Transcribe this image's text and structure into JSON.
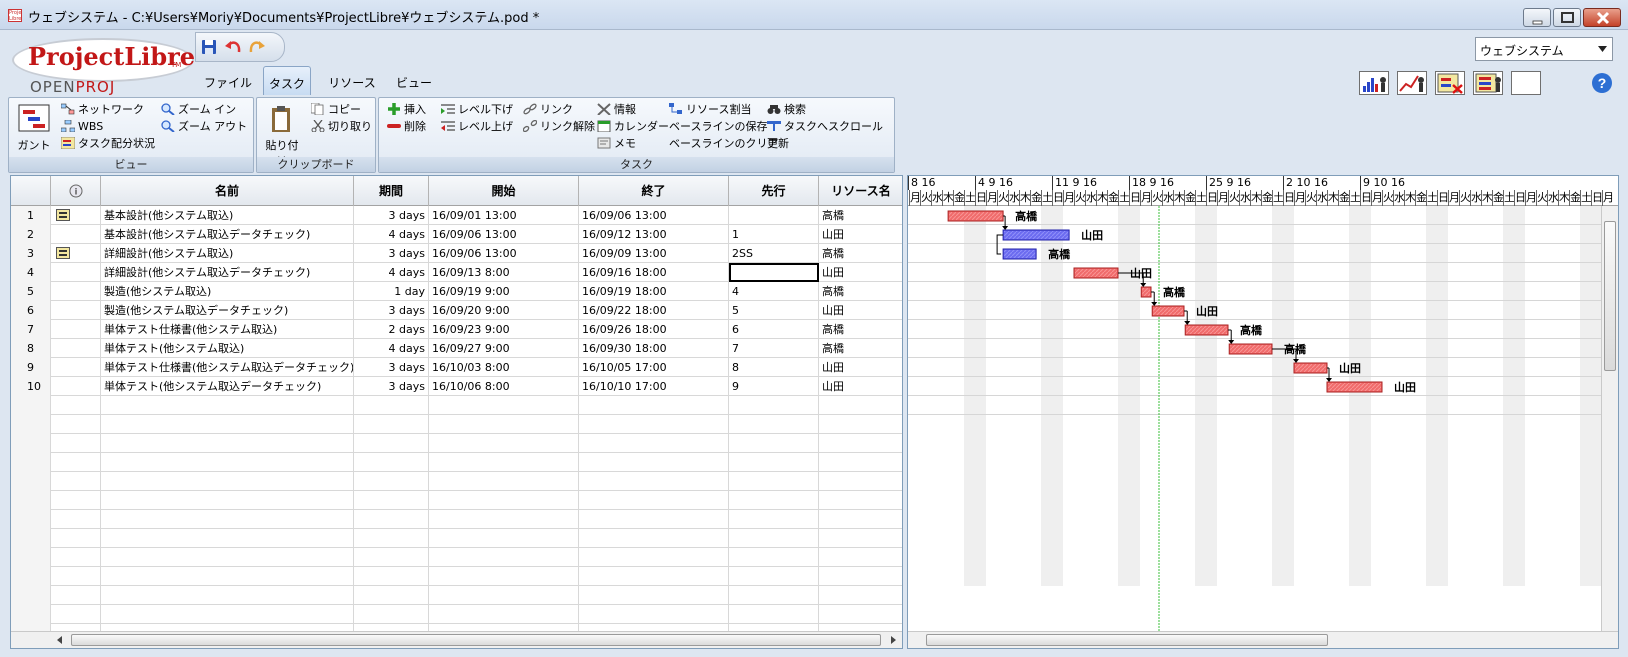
{
  "window": {
    "title": "ウェブシステム - C:¥Users¥Moriy¥Documents¥ProjectLibre¥ウェブシステム.pod *",
    "logo_small": "Project Libre"
  },
  "logo": {
    "main": "ProjectLibre",
    "tm": "TM",
    "sub_open": "OPEN",
    "sub_proj": "PROJ"
  },
  "tabs": [
    "ファイル",
    "タスク",
    "リソース",
    "ビュー"
  ],
  "active_tab": "タスク",
  "project_selector": {
    "value": "ウェブシステム"
  },
  "ribbon": {
    "view_group": {
      "label": "ビュー",
      "gantt": "ガント",
      "network": "ネットワーク",
      "wbs": "WBS",
      "task_usage": "タスク配分状況",
      "zoom_in": "ズーム イン",
      "zoom_out": "ズーム アウト"
    },
    "clipboard_group": {
      "label": "クリップボード",
      "paste": "貼り付け",
      "copy": "コピー",
      "cut": "切り取り"
    },
    "task_group": {
      "label": "タスク",
      "insert": "挿入",
      "delete": "削除",
      "indent": "レベル下げ",
      "outdent": "レベル上げ",
      "link": "リンク",
      "unlink": "リンク解除",
      "info": "情報",
      "calendar": "カレンダー",
      "notes": "メモ",
      "assign_resources": "リソース割当",
      "save_baseline": "ベースラインの保存",
      "clear_baseline": "ベースラインのクリア",
      "find": "検索",
      "scroll_to_task": "タスクへスクロール",
      "update": "更新"
    }
  },
  "table": {
    "columns": [
      "",
      "",
      "名前",
      "期間",
      "開始",
      "終了",
      "先行",
      "リソース名"
    ],
    "rows": [
      {
        "id": "1",
        "icon": true,
        "name": "基本設計(他システム取込)",
        "duration": "3 days",
        "start": "16/09/01 13:00",
        "finish": "16/09/06 13:00",
        "pred": "",
        "resource": "高橋"
      },
      {
        "id": "2",
        "icon": false,
        "name": "基本設計(他システム取込データチェック)",
        "duration": "4 days",
        "start": "16/09/06 13:00",
        "finish": "16/09/12 13:00",
        "pred": "1",
        "resource": "山田"
      },
      {
        "id": "3",
        "icon": true,
        "name": "詳細設計(他システム取込)",
        "duration": "3 days",
        "start": "16/09/06 13:00",
        "finish": "16/09/09 13:00",
        "pred": "2SS",
        "resource": "高橋"
      },
      {
        "id": "4",
        "icon": false,
        "name": "詳細設計(他システム取込データチェック)",
        "duration": "4 days",
        "start": "16/09/13 8:00",
        "finish": "16/09/16 18:00",
        "pred": "",
        "resource": "山田"
      },
      {
        "id": "5",
        "icon": false,
        "name": "製造(他システム取込)",
        "duration": "1 day",
        "start": "16/09/19 9:00",
        "finish": "16/09/19 18:00",
        "pred": "4",
        "resource": "高橋"
      },
      {
        "id": "6",
        "icon": false,
        "name": "製造(他システム取込データチェック)",
        "duration": "3 days",
        "start": "16/09/20 9:00",
        "finish": "16/09/22 18:00",
        "pred": "5",
        "resource": "山田"
      },
      {
        "id": "7",
        "icon": false,
        "name": "単体テスト仕様書(他システム取込)",
        "duration": "2 days",
        "start": "16/09/23 9:00",
        "finish": "16/09/26 18:00",
        "pred": "6",
        "resource": "高橋"
      },
      {
        "id": "8",
        "icon": false,
        "name": "単体テスト(他システム取込)",
        "duration": "4 days",
        "start": "16/09/27 9:00",
        "finish": "16/09/30 18:00",
        "pred": "7",
        "resource": "高橋"
      },
      {
        "id": "9",
        "icon": false,
        "name": "単体テスト仕様書(他システム取込データチェック)",
        "duration": "3 days",
        "start": "16/10/03 8:00",
        "finish": "16/10/05 17:00",
        "pred": "8",
        "resource": "山田"
      },
      {
        "id": "10",
        "icon": false,
        "name": "単体テスト(他システム取込データチェック)",
        "duration": "3 days",
        "start": "16/10/06 8:00",
        "finish": "16/10/10 17:00",
        "pred": "9",
        "resource": "山田"
      }
    ]
  },
  "gantt": {
    "weeks": [
      "8 16",
      "4 9 16",
      "11 9 16",
      "18 9 16",
      "25 9 16",
      "2 10 16",
      "9 10 16"
    ],
    "day_labels": [
      "月",
      "火",
      "水",
      "木",
      "金",
      "土",
      "日"
    ],
    "colors": {
      "critical": "#f06b6b",
      "normal": "#6b6bf0",
      "today_line": "#3bbf3b"
    }
  }
}
